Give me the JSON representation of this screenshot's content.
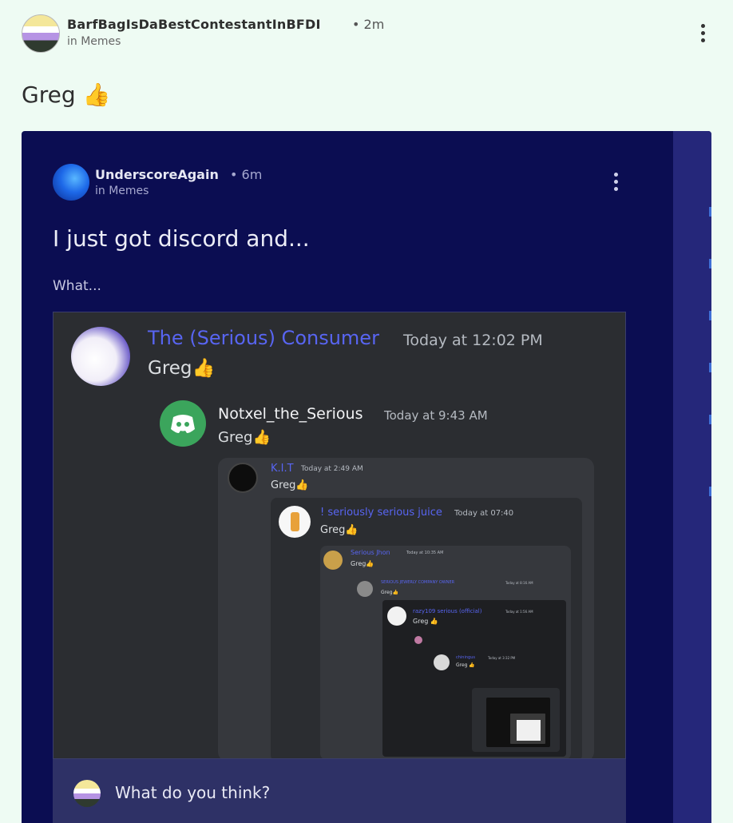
{
  "post": {
    "username": "BarfBagIsDaBestContestantInBFDI",
    "time": "• 2m",
    "community": "in Memes",
    "title": "Greg 👍",
    "more_icon": "vertical-ellipsis"
  },
  "embedded_post": {
    "username": "UnderscoreAgain",
    "time": "• 6m",
    "community": "in Memes",
    "title": "I just got discord and...",
    "body": "What...",
    "more_icon": "vertical-ellipsis"
  },
  "discord_messages": [
    {
      "name": "The (Serious) Consumer",
      "time": "Today at 12:02 PM",
      "text": "Greg👍"
    },
    {
      "name": "Notxel_the_Serious",
      "time": "Today at 9:43 AM",
      "text": "Greg👍"
    },
    {
      "name": "K.I.T",
      "time": "Today at 2:49 AM",
      "text": "Greg👍"
    },
    {
      "name": "! seriously serious juice",
      "time": "Today at 07:40",
      "text": "Greg👍"
    },
    {
      "name": "Serious Jhon",
      "time": "Today at 10:35 AM",
      "text": "Greg👍"
    },
    {
      "name": "SERIOUS JEWERLY COMPANY OWNER",
      "time": "Today at 8:16 AM",
      "text": "Greg👍"
    },
    {
      "name": "razy109 serious (official)",
      "time": "Today at 1:56 AM",
      "text": "Greg 👍"
    },
    {
      "name": "chiningus",
      "time": "Today at 3:32 PM",
      "text": "Greg 👍"
    }
  ],
  "comment": {
    "placeholder": "What do you think?"
  },
  "colors": {
    "background": "#eefbf3",
    "embed_bg": "#0b0d52",
    "discord_bg": "#2b2d31",
    "discord_name": "#5865f2",
    "discord_green": "#3ba55c"
  }
}
